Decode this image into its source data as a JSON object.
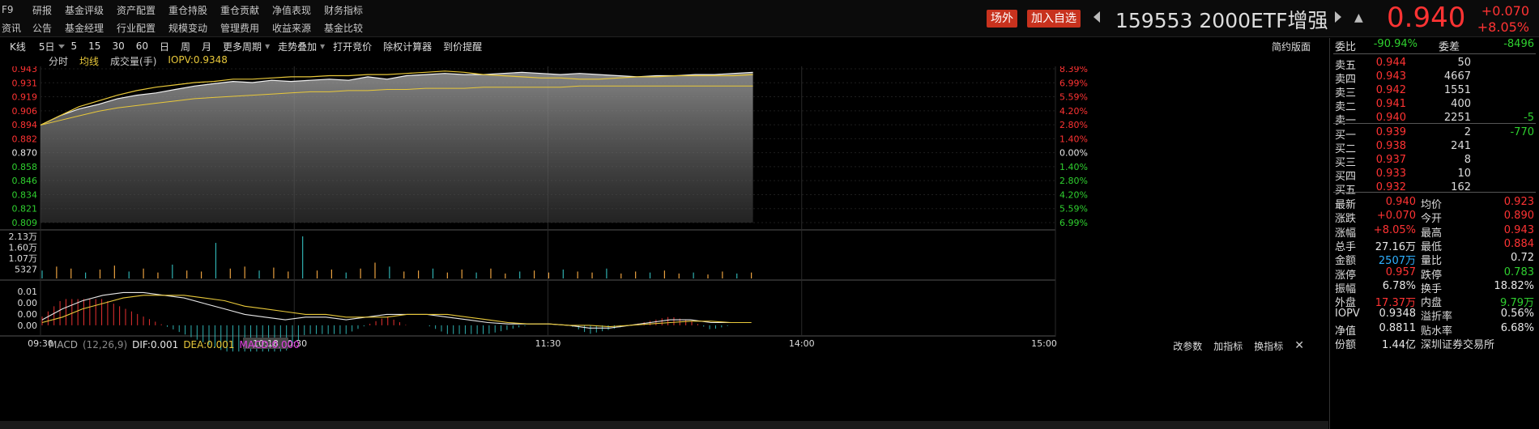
{
  "nav": {
    "row1": [
      "F9",
      "研报",
      "基金评级",
      "资产配置",
      "重仓持股",
      "重仓贡献",
      "净值表现",
      "财务指标"
    ],
    "row2": [
      "资讯",
      "公告",
      "基金经理",
      "行业配置",
      "规模变动",
      "管理费用",
      "收益来源",
      "基金比较"
    ]
  },
  "header": {
    "offsite_label": "场外",
    "add_watch_label": "加入自选",
    "code": "159553",
    "name": "2000ETF增强",
    "last_price": "0.940",
    "change": "+0.070",
    "change_pct": "+8.05%"
  },
  "toolbar": {
    "items": [
      "K线",
      "5日",
      "5",
      "15",
      "30",
      "60",
      "日",
      "周",
      "月",
      "更多周期",
      "走势叠加",
      "打开竞价",
      "除权计算器",
      "到价提醒"
    ],
    "simple_label": "简约版面"
  },
  "legend": {
    "fenshi": "分时",
    "avg": "均线",
    "volume": "成交量(手)",
    "iopv": "IOPV:0.9348"
  },
  "colors": {
    "up": "#ff3333",
    "down": "#2fd02f",
    "price_line": "#f0f0f0",
    "avg_line": "#e8c83a",
    "macd": "#e040e0",
    "neutral": "#e8e8e8"
  },
  "chart_data": {
    "type": "line",
    "price_axis": [
      "0.943",
      "0.931",
      "0.919",
      "0.906",
      "0.894",
      "0.882",
      "0.870",
      "0.858",
      "0.846",
      "0.834",
      "0.821",
      "0.809"
    ],
    "pct_axis": [
      "8.39%",
      "6.99%",
      "5.59%",
      "4.20%",
      "2.80%",
      "1.40%",
      "0.00%",
      "1.40%",
      "2.80%",
      "4.20%",
      "5.59%",
      "6.99%"
    ],
    "ylim": [
      0.809,
      0.943
    ],
    "prev_close": 0.87,
    "time_labels": [
      "09:30",
      "10:30",
      "11:30",
      "14:00",
      "15:00"
    ],
    "cursor_time": "10:18",
    "price_series": [
      0.894,
      0.902,
      0.908,
      0.912,
      0.917,
      0.92,
      0.922,
      0.925,
      0.928,
      0.93,
      0.932,
      0.931,
      0.933,
      0.932,
      0.933,
      0.934,
      0.933,
      0.936,
      0.934,
      0.937,
      0.938,
      0.939,
      0.938,
      0.938,
      0.939,
      0.94,
      0.939,
      0.938,
      0.939,
      0.938,
      0.937,
      0.936,
      0.937,
      0.937,
      0.938,
      0.938,
      0.939,
      0.94
    ],
    "avg_series": [
      0.894,
      0.898,
      0.902,
      0.906,
      0.909,
      0.911,
      0.913,
      0.915,
      0.917,
      0.918,
      0.919,
      0.92,
      0.921,
      0.922,
      0.923,
      0.923,
      0.924,
      0.924,
      0.925,
      0.925,
      0.926,
      0.926,
      0.926,
      0.927,
      0.927,
      0.927,
      0.927,
      0.927,
      0.928,
      0.928,
      0.928,
      0.928,
      0.928,
      0.928,
      0.928,
      0.928,
      0.928,
      0.928
    ],
    "iopv_series": [
      0.894,
      0.902,
      0.91,
      0.915,
      0.92,
      0.924,
      0.927,
      0.929,
      0.931,
      0.932,
      0.934,
      0.934,
      0.935,
      0.936,
      0.936,
      0.937,
      0.937,
      0.938,
      0.938,
      0.939,
      0.94,
      0.941,
      0.94,
      0.938,
      0.937,
      0.936,
      0.935,
      0.935,
      0.934,
      0.934,
      0.935,
      0.936,
      0.936,
      0.937,
      0.937,
      0.937,
      0.937,
      0.938
    ],
    "volume_axis": [
      "2.13万",
      "1.60万",
      "1.07万",
      "5327"
    ],
    "volume_max": 21300,
    "volume_series": [
      4000,
      6000,
      5000,
      3000,
      4500,
      6500,
      3500,
      5000,
      3000,
      7000,
      4000,
      3500,
      18000,
      5000,
      6000,
      4000,
      5500,
      3500,
      21300,
      4000,
      4500,
      3000,
      5000,
      8000,
      6000,
      3500,
      4000,
      5000,
      3000,
      4500,
      3000,
      5000,
      2500,
      3500,
      4000,
      3000,
      4500,
      3500,
      3000,
      5000,
      2500,
      3500,
      3000,
      4000,
      2500,
      3000,
      2000,
      3500,
      2500,
      3000
    ],
    "macd_axis": [
      "0.01",
      "0.00",
      "0.00",
      "0.00"
    ],
    "macd_label": "MACD",
    "macd_params": "(12,26,9)",
    "dif_label": "DIF:0.001",
    "dea_label": "DEA:0.001",
    "macd_value_label": "MACD:0.000",
    "dif_series": [
      0.002,
      0.006,
      0.009,
      0.011,
      0.012,
      0.012,
      0.011,
      0.01,
      0.008,
      0.006,
      0.004,
      0.003,
      0.002,
      0.003,
      0.003,
      0.002,
      0.003,
      0.004,
      0.004,
      0.004,
      0.003,
      0.002,
      0.001,
      0.0005,
      0.0005,
      0.0005,
      0.0,
      -0.001,
      -0.001,
      0.0,
      0.001,
      0.002,
      0.002,
      0.001,
      0.001,
      0.001
    ],
    "dea_series": [
      0.001,
      0.003,
      0.006,
      0.008,
      0.01,
      0.011,
      0.011,
      0.011,
      0.01,
      0.009,
      0.007,
      0.006,
      0.005,
      0.004,
      0.004,
      0.003,
      0.003,
      0.003,
      0.004,
      0.004,
      0.004,
      0.003,
      0.002,
      0.001,
      0.0005,
      0.0005,
      0.0,
      0.0,
      -0.0005,
      0.0,
      0.0005,
      0.001,
      0.0015,
      0.0015,
      0.001,
      0.001
    ],
    "macd_range": [
      -0.003,
      0.013
    ]
  },
  "macd_tools": [
    "改参数",
    "加指标",
    "换指标"
  ],
  "order_book": {
    "weibi_label": "委比",
    "weibi": "-90.94%",
    "weicha_label": "委差",
    "weicha": "-8496",
    "asks": [
      {
        "label": "卖五",
        "price": "0.944",
        "vol": "50",
        "chg": ""
      },
      {
        "label": "卖四",
        "price": "0.943",
        "vol": "4667",
        "chg": ""
      },
      {
        "label": "卖三",
        "price": "0.942",
        "vol": "1551",
        "chg": ""
      },
      {
        "label": "卖二",
        "price": "0.941",
        "vol": "400",
        "chg": ""
      },
      {
        "label": "卖一",
        "price": "0.940",
        "vol": "2251",
        "chg": "-5"
      }
    ],
    "bids": [
      {
        "label": "买一",
        "price": "0.939",
        "vol": "2",
        "chg": "-770"
      },
      {
        "label": "买二",
        "price": "0.938",
        "vol": "241",
        "chg": ""
      },
      {
        "label": "买三",
        "price": "0.937",
        "vol": "8",
        "chg": ""
      },
      {
        "label": "买四",
        "price": "0.933",
        "vol": "10",
        "chg": ""
      },
      {
        "label": "买五",
        "price": "0.932",
        "vol": "162",
        "chg": ""
      }
    ]
  },
  "stats": [
    {
      "l1": "最新",
      "v1": "0.940",
      "c1": "red",
      "l2": "均价",
      "v2": "0.923",
      "c2": "red"
    },
    {
      "l1": "涨跌",
      "v1": "+0.070",
      "c1": "red",
      "l2": "今开",
      "v2": "0.890",
      "c2": "red"
    },
    {
      "l1": "涨幅",
      "v1": "+8.05%",
      "c1": "red",
      "l2": "最高",
      "v2": "0.943",
      "c2": "red"
    },
    {
      "l1": "总手",
      "v1": "27.16万",
      "c1": "white",
      "l2": "最低",
      "v2": "0.884",
      "c2": "red"
    },
    {
      "l1": "金额",
      "v1": "2507万",
      "c1": "cyan",
      "l2": "量比",
      "v2": "0.72",
      "c2": "white"
    },
    {
      "l1": "涨停",
      "v1": "0.957",
      "c1": "red",
      "l2": "跌停",
      "v2": "0.783",
      "c2": "green"
    },
    {
      "l1": "振幅",
      "v1": "6.78%",
      "c1": "white",
      "l2": "换手",
      "v2": "18.82%",
      "c2": "white"
    },
    {
      "l1": "外盘",
      "v1": "17.37万",
      "c1": "red",
      "l2": "内盘",
      "v2": "9.79万",
      "c2": "green"
    },
    {
      "l1": "IOPV",
      "v1": "0.9348",
      "c1": "white",
      "l2": "溢折率",
      "v2": "0.56%",
      "c2": "white"
    },
    {
      "l1": "净值",
      "v1": "0.8811",
      "c1": "white",
      "l2": "贴水率",
      "v2": "6.68%",
      "c2": "white"
    },
    {
      "l1": "份额",
      "v1": "1.44亿",
      "c1": "white",
      "l2": "深圳证券交易所",
      "v2": "",
      "c2": "white"
    }
  ]
}
